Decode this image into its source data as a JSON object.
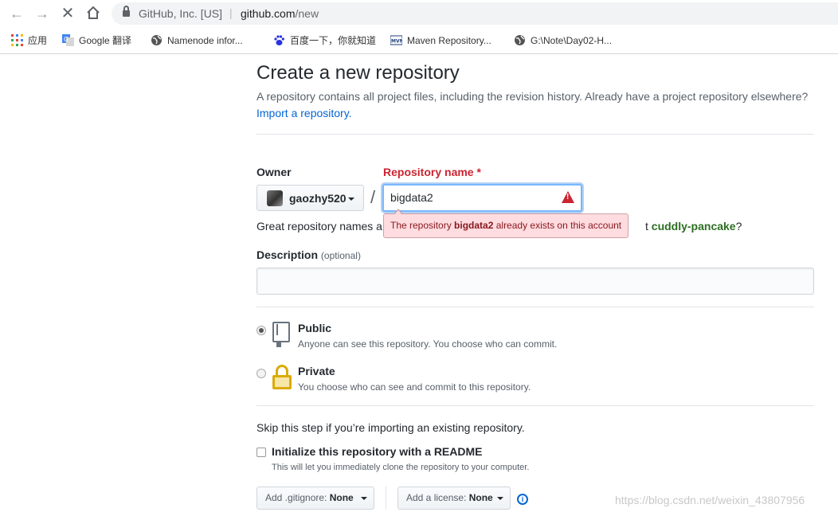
{
  "browser": {
    "site_identity": "GitHub, Inc. [US]",
    "url_host": "github.com",
    "url_path": "/new"
  },
  "bookmarks": [
    {
      "label": "应用",
      "icon": "apps-grid-icon"
    },
    {
      "label": "Google 翻译",
      "icon": "google-translate-icon"
    },
    {
      "label": "Namenode infor...",
      "icon": "globe-icon"
    },
    {
      "label": "百度一下，你就知道",
      "icon": "baidu-paw-icon"
    },
    {
      "label": "Maven Repository...",
      "icon": "maven-icon"
    },
    {
      "label": "G:\\Note\\Day02-H...",
      "icon": "globe-icon"
    }
  ],
  "page": {
    "title": "Create a new repository",
    "subtitle": "A repository contains all project files, including the revision history. Already have a project repository elsewhere?",
    "import_link": "Import a repository."
  },
  "form": {
    "owner_label": "Owner",
    "owner_name": "gaozhy520",
    "repo_label": "Repository name",
    "required_mark": "*",
    "repo_value": "bigdata2",
    "hint_prefix": "Great repository names ar",
    "hint_suffix_pre": "t ",
    "hint_suggestion": "cuddly-pancake",
    "hint_suffix_post": "?",
    "error_prefix": "The repository ",
    "error_name": "bigdata2",
    "error_suffix": " already exists on this account",
    "description_label": "Description",
    "description_optional": "(optional)",
    "description_value": "",
    "visibility": [
      {
        "title": "Public",
        "desc": "Anyone can see this repository. You choose who can commit.",
        "checked": true
      },
      {
        "title": "Private",
        "desc": "You choose who can see and commit to this repository.",
        "checked": false
      }
    ],
    "skip_text": "Skip this step if you’re importing an existing repository.",
    "init_title": "Initialize this repository with a README",
    "init_desc": "This will let you immediately clone the repository to your computer.",
    "gitignore_label": "Add .gitignore:",
    "gitignore_value": "None",
    "license_label": "Add a license:",
    "license_value": "None"
  },
  "watermark": "https://blog.csdn.net/weixin_43807956"
}
